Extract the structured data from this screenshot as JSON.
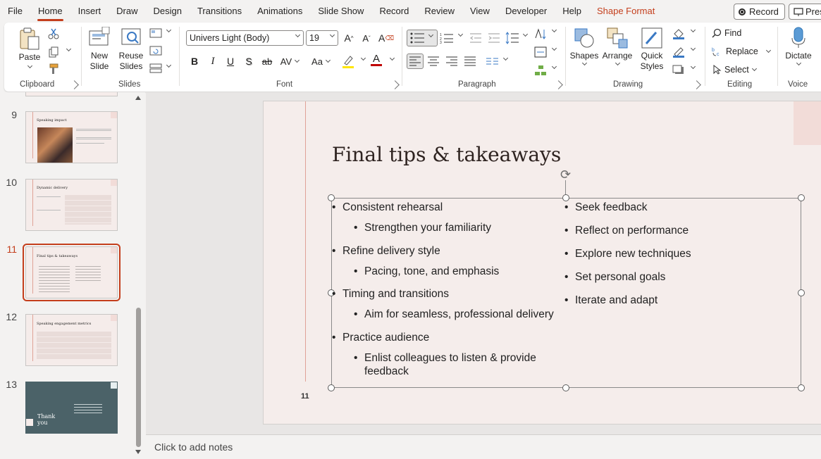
{
  "menu": {
    "items": [
      "File",
      "Home",
      "Insert",
      "Draw",
      "Design",
      "Transitions",
      "Animations",
      "Slide Show",
      "Record",
      "Review",
      "View",
      "Developer",
      "Help"
    ],
    "contextual": "Shape Format",
    "record_label": "Record",
    "present_label": "Pres"
  },
  "ribbon": {
    "clipboard": {
      "paste": "Paste",
      "label": "Clipboard"
    },
    "slides": {
      "new_slide_1": "New",
      "new_slide_2": "Slide",
      "reuse_1": "Reuse",
      "reuse_2": "Slides",
      "label": "Slides"
    },
    "font": {
      "name": "Univers Light (Body)",
      "size": "19",
      "label": "Font",
      "bold": "B",
      "italic": "I",
      "underline": "U",
      "shadow": "S",
      "strike": "ab"
    },
    "paragraph": {
      "label": "Paragraph"
    },
    "drawing": {
      "shapes": "Shapes",
      "arrange": "Arrange",
      "quick_1": "Quick",
      "quick_2": "Styles",
      "label": "Drawing"
    },
    "editing": {
      "find": "Find",
      "replace": "Replace",
      "select": "Select",
      "label": "Editing"
    },
    "voice": {
      "dictate": "Dictate",
      "label": "Voice"
    }
  },
  "thumbnails": [
    {
      "num": "9",
      "title": "Speaking impact"
    },
    {
      "num": "10",
      "title": "Dynamic delivery"
    },
    {
      "num": "11",
      "title": "Final tips & takeaways"
    },
    {
      "num": "12",
      "title": "Speaking engagement metrics"
    },
    {
      "num": "13",
      "title": "Thank you"
    }
  ],
  "slide": {
    "title": "Final tips & takeaways",
    "number": "11",
    "left_column": [
      "Consistent rehearsal",
      "Strengthen your familiarity",
      "Refine delivery style",
      "Pacing, tone, and emphasis",
      "Timing and transitions",
      "Aim for seamless, professional delivery",
      "Practice audience",
      "Enlist colleagues to listen & provide",
      "feedback"
    ],
    "right_column": [
      "Seek feedback",
      "Reflect on performance",
      "Explore new techniques",
      "Set personal goals",
      "Iterate and adapt"
    ]
  },
  "notes": {
    "placeholder": "Click to add notes"
  },
  "colors": {
    "accent": "#c43e1c",
    "slide_bg": "#f5edeb",
    "thumb13_bg": "#4b6268"
  }
}
